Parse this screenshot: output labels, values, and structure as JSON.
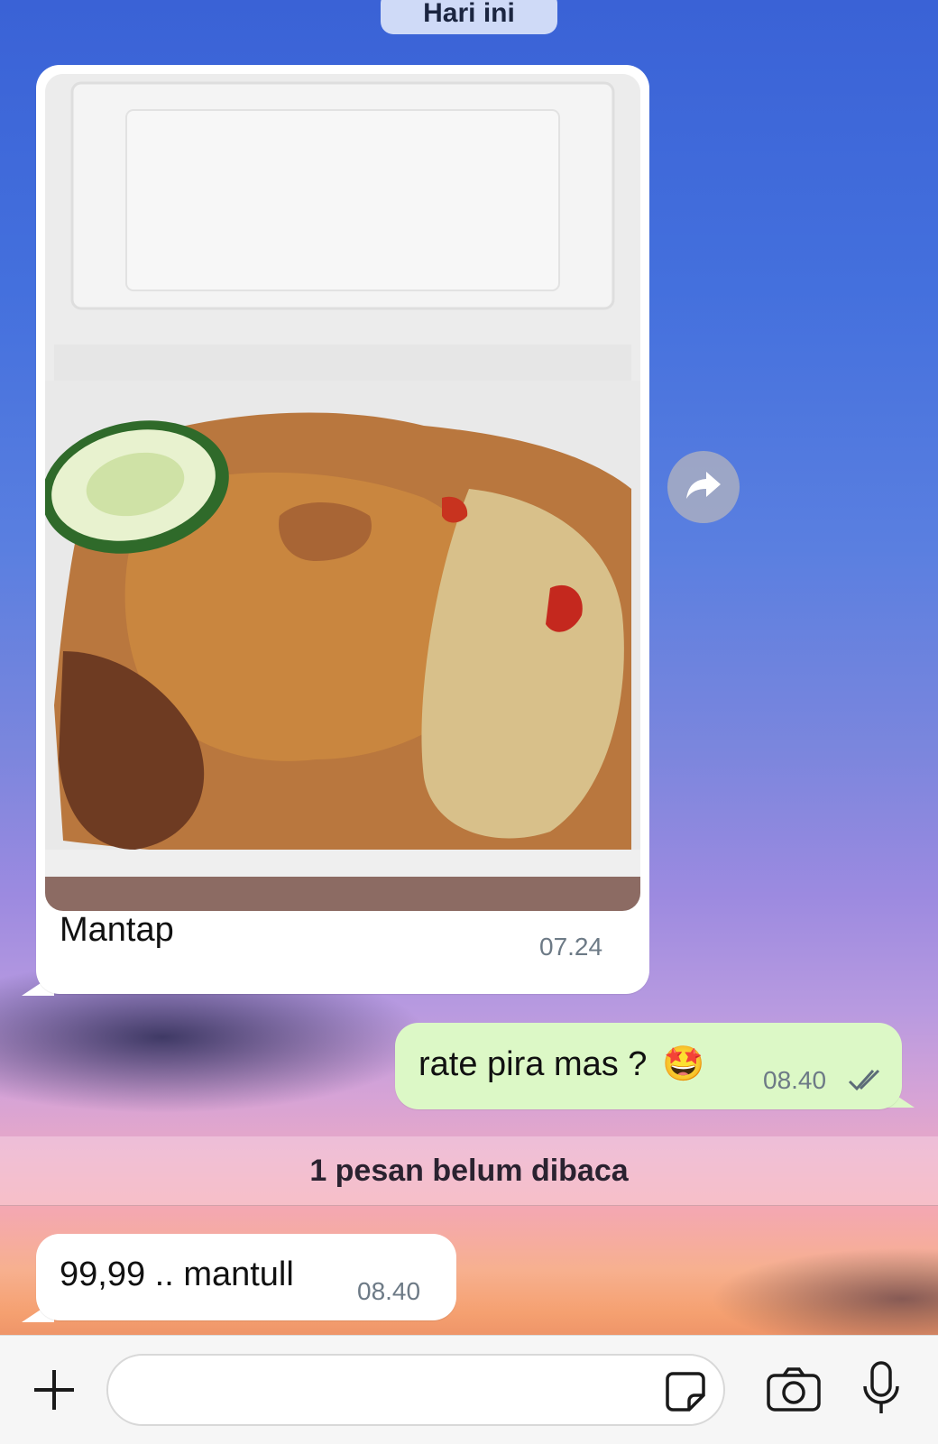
{
  "chat": {
    "day_label": "Hari ini",
    "unread_banner": "1 pesan belum dibaca",
    "messages": [
      {
        "direction": "incoming",
        "type": "image",
        "caption": "Mantap",
        "time": "07.24"
      },
      {
        "direction": "outgoing",
        "type": "text",
        "text": "rate pira mas ?",
        "emoji": "🤩",
        "time": "08.40",
        "status": "read"
      },
      {
        "direction": "incoming",
        "type": "text",
        "text": "99,99 .. mantull",
        "time": "08.40"
      }
    ]
  },
  "composer": {
    "placeholder": "",
    "icons": [
      "plus-icon",
      "sticker-icon",
      "camera-icon",
      "microphone-icon"
    ]
  },
  "colors": {
    "incoming_bubble": "#ffffff",
    "outgoing_bubble": "#dcf8c6",
    "timestamp": "#6d7a86"
  }
}
